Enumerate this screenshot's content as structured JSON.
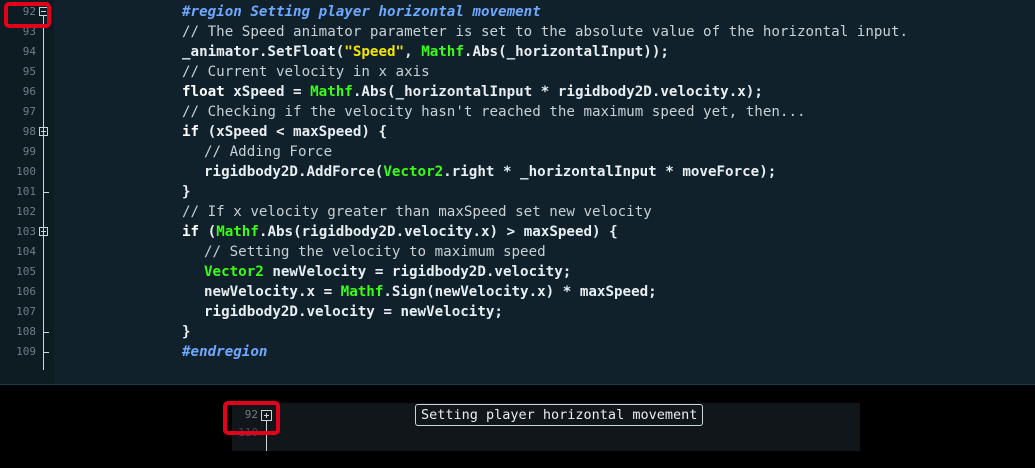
{
  "editor": {
    "lines": [
      {
        "num": "92",
        "segments": [
          [
            "rg",
            "#region Setting player horizontal movement"
          ]
        ]
      },
      {
        "num": "93",
        "segments": [
          [
            "cm",
            "// The Speed animator parameter is set to the absolute value of the horizontal input."
          ]
        ]
      },
      {
        "num": "94",
        "segments": [
          [
            "p",
            "_animator.SetFloat("
          ],
          [
            "str",
            "\"Speed\""
          ],
          [
            "p",
            ", "
          ],
          [
            "ty",
            "Mathf"
          ],
          [
            "p",
            ".Abs(_horizontalInput));"
          ]
        ]
      },
      {
        "num": "95",
        "segments": [
          [
            "cm",
            "// Current velocity in x axis"
          ]
        ]
      },
      {
        "num": "96",
        "segments": [
          [
            "kw",
            "float"
          ],
          [
            "p",
            " xSpeed = "
          ],
          [
            "ty",
            "Mathf"
          ],
          [
            "p",
            ".Abs(_horizontalInput * rigidbody2D.velocity.x);"
          ]
        ]
      },
      {
        "num": "97",
        "segments": [
          [
            "cm",
            "// Checking if the velocity hasn't reached the maximum speed yet, then..."
          ]
        ]
      },
      {
        "num": "98",
        "segments": [
          [
            "kw",
            "if"
          ],
          [
            "p",
            " (xSpeed < maxSpeed) {"
          ]
        ]
      },
      {
        "num": "99",
        "indent": 1,
        "segments": [
          [
            "cm",
            "// Adding Force"
          ]
        ]
      },
      {
        "num": "100",
        "indent": 1,
        "segments": [
          [
            "p",
            "rigidbody2D.AddForce("
          ],
          [
            "ty",
            "Vector2"
          ],
          [
            "p",
            ".right * _horizontalInput * moveForce);"
          ]
        ]
      },
      {
        "num": "101",
        "segments": [
          [
            "p",
            "}"
          ]
        ]
      },
      {
        "num": "102",
        "segments": [
          [
            "cm",
            "// If x velocity greater than maxSpeed set new velocity"
          ]
        ]
      },
      {
        "num": "103",
        "segments": [
          [
            "kw",
            "if"
          ],
          [
            "p",
            " ("
          ],
          [
            "ty",
            "Mathf"
          ],
          [
            "p",
            ".Abs(rigidbody2D.velocity.x) > maxSpeed) {"
          ]
        ]
      },
      {
        "num": "104",
        "indent": 1,
        "segments": [
          [
            "cm",
            "// Setting the velocity to maximum speed"
          ]
        ]
      },
      {
        "num": "105",
        "indent": 1,
        "segments": [
          [
            "ty",
            "Vector2"
          ],
          [
            "p",
            " newVelocity = rigidbody2D.velocity;"
          ]
        ]
      },
      {
        "num": "106",
        "indent": 1,
        "segments": [
          [
            "p",
            "newVelocity.x = "
          ],
          [
            "ty",
            "Mathf"
          ],
          [
            "p",
            ".Sign(newVelocity.x) * maxSpeed;"
          ]
        ]
      },
      {
        "num": "107",
        "indent": 1,
        "segments": [
          [
            "p",
            "rigidbody2D.velocity = newVelocity;"
          ]
        ]
      },
      {
        "num": "108",
        "segments": [
          [
            "p",
            "}"
          ]
        ]
      },
      {
        "num": "109",
        "segments": [
          [
            "rg",
            "#endregion"
          ]
        ]
      }
    ]
  },
  "collapsed_view": {
    "line_number": "92",
    "next_line_number": "110",
    "summary_label": "Setting player horizontal movement"
  },
  "colors": {
    "editor_bg": "#10212b",
    "keyword_type": "#39ff14",
    "string": "#f5e500",
    "region": "#6fa8ff",
    "highlight": "#e3001b"
  }
}
